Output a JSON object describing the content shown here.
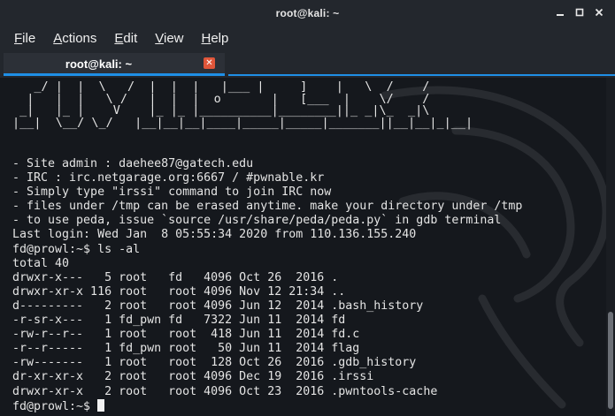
{
  "window": {
    "title": "root@kali: ~",
    "controls": [
      "minimize-icon",
      "maximize-icon",
      "close-icon"
    ]
  },
  "menubar": {
    "items": [
      {
        "mnemonic": "F",
        "rest": "ile"
      },
      {
        "mnemonic": "A",
        "rest": "ctions"
      },
      {
        "mnemonic": "E",
        "rest": "dit"
      },
      {
        "mnemonic": "V",
        "rest": "iew"
      },
      {
        "mnemonic": "H",
        "rest": "elp"
      }
    ]
  },
  "tab": {
    "label": "root@kali: ~",
    "close_glyph": "✕"
  },
  "colors": {
    "accent": "#1f8fe6",
    "tab_close": "#e0563a",
    "terminal_bg": "#15181d",
    "text": "#e4e4e4"
  },
  "terminal": {
    "banner": [
      "   _/ |  |  \\   /  |  |  |   |___ |     ]    |   \\  /    /",
      "  |   |  |   \\ /   |  |  |  o       |   [___  |    \\/    /",
      " _|   |_ |    V    |_ |_ |__________|________||_ _|\\_  _|\\",
      "|__|  \\__/ \\_/   |__|__|__|____|_____|_____|_______||__|__|_|__|"
    ],
    "lines": [
      "- Site admin : daehee87@gatech.edu",
      "- IRC : irc.netgarage.org:6667 / #pwnable.kr",
      "- Simply type \"irssi\" command to join IRC now",
      "- files under /tmp can be erased anytime. make your directory under /tmp",
      "- to use peda, issue `source /usr/share/peda/peda.py` in gdb terminal",
      "Last login: Wed Jan  8 05:55:34 2020 from 110.136.155.240",
      "fd@prowl:~$ ls -al",
      "total 40",
      "drwxr-x---   5 root   fd   4096 Oct 26  2016 .",
      "drwxr-xr-x 116 root   root 4096 Nov 12 21:34 ..",
      "d---------   2 root   root 4096 Jun 12  2014 .bash_history",
      "-r-sr-x---   1 fd_pwn fd   7322 Jun 11  2014 fd",
      "-rw-r--r--   1 root   root  418 Jun 11  2014 fd.c",
      "-r--r-----   1 fd_pwn root   50 Jun 11  2014 flag",
      "-rw-------   1 root   root  128 Oct 26  2016 .gdb_history",
      "dr-xr-xr-x   2 root   root 4096 Dec 19  2016 .irssi",
      "drwxr-xr-x   2 root   root 4096 Oct 23  2016 .pwntools-cache"
    ],
    "prompt": "fd@prowl:~$ "
  }
}
